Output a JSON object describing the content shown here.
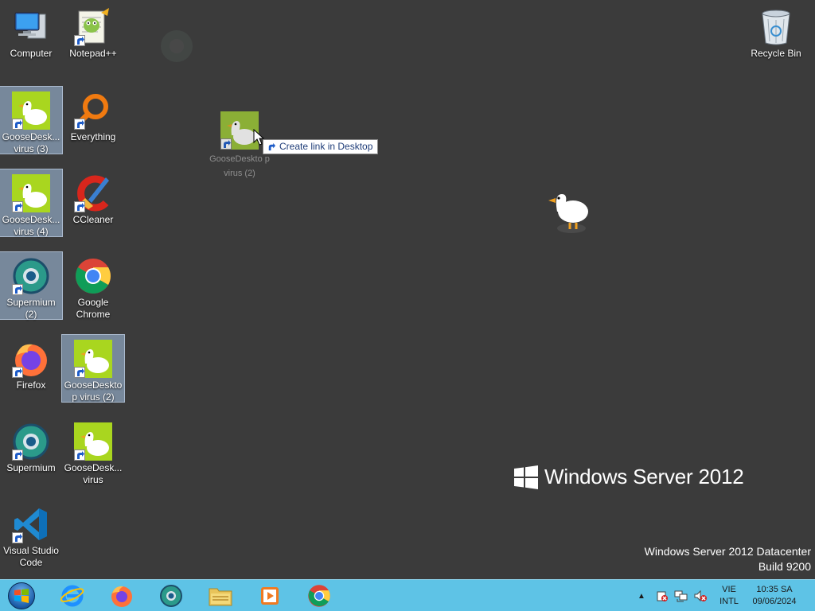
{
  "desktop": {
    "icons": {
      "computer": "Computer",
      "notepadpp": "Notepad++",
      "recycle_bin": "Recycle Bin",
      "goose3": "GooseDesk... virus (3)",
      "everything": "Everything",
      "goose4": "GooseDesk... virus (4)",
      "ccleaner": "CCleaner",
      "supermium2": "Supermium (2)",
      "chrome": "Google Chrome",
      "firefox": "Firefox",
      "goose2": "GooseDeskto p virus (2)",
      "supermium": "Supermium",
      "goose": "GooseDesk... virus",
      "vscode": "Visual Studio Code"
    },
    "drag": {
      "ghost_label": "GooseDeskto p virus (2)",
      "tooltip": "Create link in Desktop"
    },
    "brand": "Windows Server 2012",
    "watermark_line1": "Windows Server 2012 Datacenter",
    "watermark_line2": "Build 9200"
  },
  "taskbar": {
    "apps": [
      "start-button",
      "internet-explorer-icon",
      "firefox-icon",
      "supermium-icon",
      "file-explorer-icon",
      "media-player-icon",
      "chrome-icon"
    ],
    "lang_line1": "VIE",
    "lang_line2": "INTL",
    "time": "10:35 SA",
    "date": "09/06/2024"
  },
  "colors": {
    "desktop_bg": "#3b3b3b",
    "taskbar_bg": "#5ec3e6",
    "goose_tile": "#a9d61f",
    "selection": "#aac8eb"
  }
}
